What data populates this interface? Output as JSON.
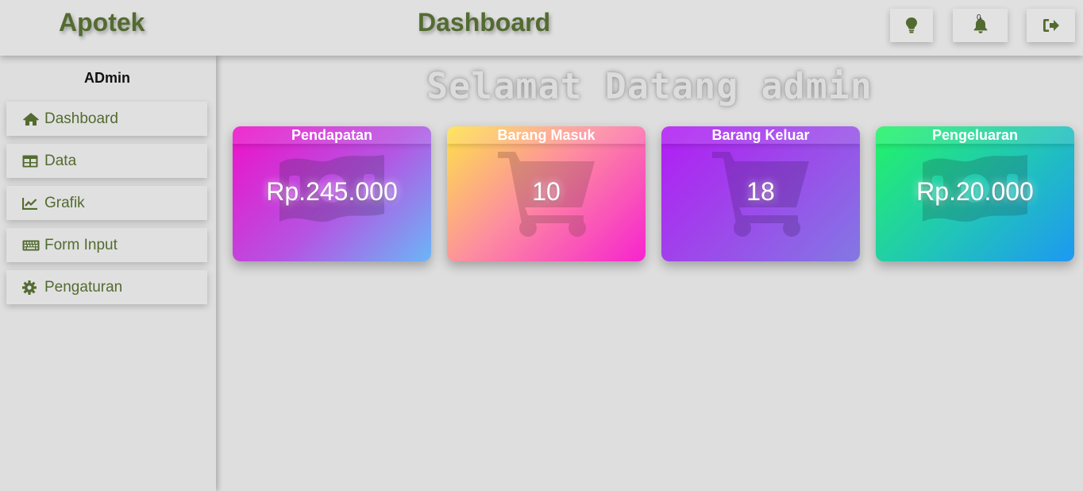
{
  "header": {
    "app_title": "Apotek",
    "page_title": "Dashboard",
    "notification_count": "0",
    "icons": [
      "lightbulb-icon",
      "bell-icon",
      "logout-icon"
    ]
  },
  "sidebar": {
    "user_name": "ADmin",
    "items": [
      {
        "label": "Dashboard",
        "icon": "home-icon"
      },
      {
        "label": "Data",
        "icon": "table-icon"
      },
      {
        "label": "Grafik",
        "icon": "line-chart-icon"
      },
      {
        "label": "Form Input",
        "icon": "keyboard-icon"
      },
      {
        "label": "Pengaturan",
        "icon": "gear-icon"
      }
    ]
  },
  "main": {
    "welcome_text": "Selamat Datang admin",
    "cards": [
      {
        "title": "Pendapatan",
        "value": "Rp.245.000",
        "icon": "money-icon"
      },
      {
        "title": "Barang Masuk",
        "value": "10",
        "icon": "cart-icon"
      },
      {
        "title": "Barang Keluar",
        "value": "18",
        "icon": "cart-icon"
      },
      {
        "title": "Pengeluaran",
        "value": "Rp.20.000",
        "icon": "money-icon"
      }
    ]
  },
  "colors": {
    "accent": "#536b30",
    "background": "#dedede",
    "card_pendapatan": [
      "#ee10c9",
      "#6bb6f6"
    ],
    "card_barang_masuk": [
      "#fde24a",
      "#f723cf"
    ],
    "card_barang_keluar": [
      "#b21cf4",
      "#8278e4"
    ],
    "card_pengeluaran": [
      "#22f466",
      "#1e98f2"
    ]
  }
}
